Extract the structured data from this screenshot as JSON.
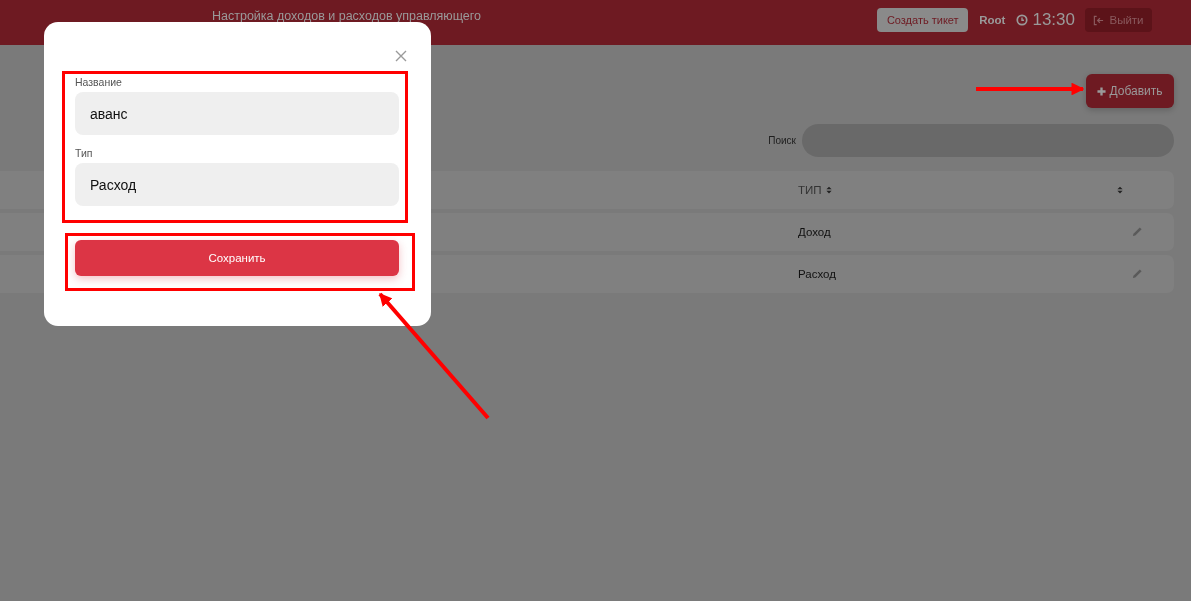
{
  "header": {
    "title": "Настройка доходов и расходов управляющего",
    "ticket_button": "Создать тикет",
    "user": "Root",
    "time": "13:30",
    "logout_button": "Выйти"
  },
  "add_button": "Добавить",
  "search": {
    "label": "Поиск"
  },
  "table": {
    "columns": [
      {
        "label": "ТИП",
        "sortable": true
      },
      {
        "sortable": true
      }
    ],
    "rows": [
      {
        "type": "Доход"
      },
      {
        "type": "Расход"
      }
    ]
  },
  "modal": {
    "fields": [
      {
        "label": "Название",
        "value": "аванс"
      },
      {
        "label": "Тип",
        "value": "Расход"
      }
    ],
    "submit": "Сохранить"
  }
}
